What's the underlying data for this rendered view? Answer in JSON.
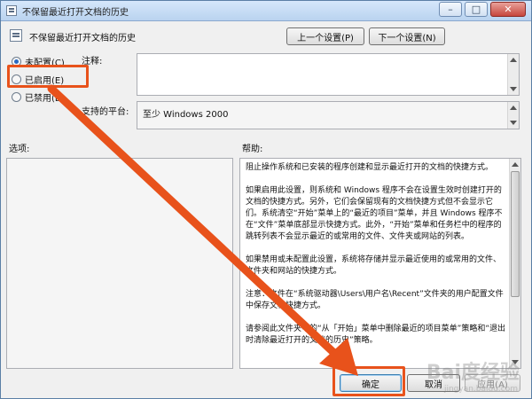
{
  "window": {
    "title": "不保留最近打开文档的历史",
    "controls": [
      "minimize-icon",
      "maximize-icon",
      "close-icon"
    ]
  },
  "header": {
    "title": "不保留最近打开文档的历史",
    "prev_label": "上一个设置(P)",
    "next_label": "下一个设置(N)"
  },
  "radios": [
    {
      "label": "未配置(C)",
      "checked": true
    },
    {
      "label": "已启用(E)",
      "checked": false
    },
    {
      "label": "已禁用(D)",
      "checked": false
    }
  ],
  "comment_label": "注释:",
  "platform_label": "支持的平台:",
  "platform_value": "至少 Windows 2000",
  "options_label": "选项:",
  "help_label": "帮助:",
  "help_paragraphs": [
    "阻止操作系统和已安装的程序创建和显示最近打开的文档的快捷方式。",
    "如果启用此设置，则系统和 Windows 程序不会在设置生效时创建打开的文档的快捷方式。另外，它们会保留现有的文档快捷方式但不会显示它们。系统清空“开始”菜单上的“最近的项目”菜单，并且 Windows 程序不在“文件”菜单底部显示快捷方式。此外，“开始”菜单和任务栏中的程序的跳转列表不会显示最近的或常用的文件、文件夹或网站的列表。",
    "如果禁用或未配置此设置，系统将存储并显示最近使用的或常用的文件、文件夹和网站的快捷方式。",
    "注意：文件在“系统驱动器\\Users\\用户名\\Recent”文件夹的用户配置文件中保存文档快捷方式。",
    "请参阅此文件夹中的“从「开始」菜单中删除最近的项目菜单”策略和“退出时清除最近打开的文档的历史”策略。"
  ],
  "footer": {
    "ok_label": "确定",
    "cancel_label": "取消",
    "apply_label": "应用(A)"
  },
  "watermark": "Bai度经验",
  "watermark_sub": "jingyan.baidu.com",
  "annotation_color": "#e8521b"
}
